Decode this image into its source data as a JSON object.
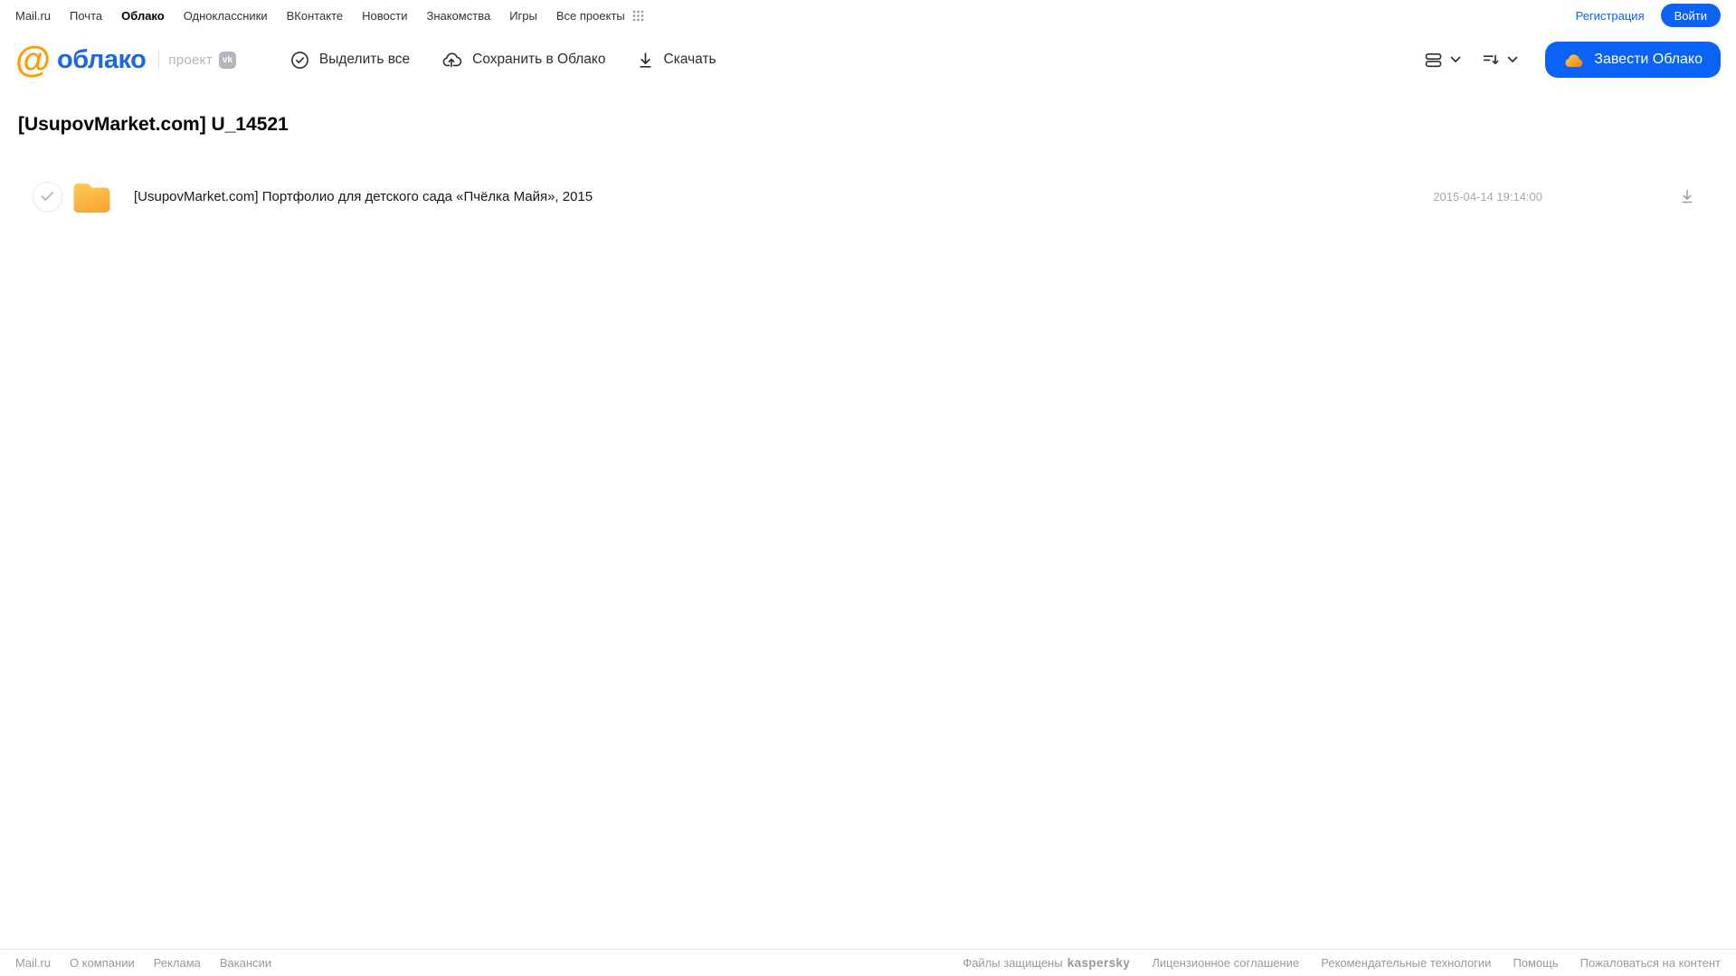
{
  "top_nav": {
    "links": [
      "Mail.ru",
      "Почта",
      "Облако",
      "Одноклассники",
      "ВКонтакте",
      "Новости",
      "Знакомства",
      "Игры",
      "Все проекты"
    ],
    "active_link": "Облако",
    "registration_label": "Регистрация",
    "login_label": "Войти"
  },
  "header": {
    "logo": {
      "at": "@",
      "name": "облако",
      "project": "проект",
      "vk": "vk"
    },
    "actions": {
      "select_all": "Выделить все",
      "save_to_cloud": "Сохранить в Облако",
      "download": "Скачать"
    },
    "get_cloud_label": "Завести Облако"
  },
  "main": {
    "title": "[UsupovMarket.com] U_14521",
    "file": {
      "type": "folder",
      "name": "[UsupovMarket.com] Портфолио для детского сада «Пчёлка Майя», 2015",
      "date": "2015-04-14 19:14:00"
    }
  },
  "footer": {
    "links_left": [
      "Mail.ru",
      "О компании",
      "Реклама",
      "Вакансии"
    ],
    "protected_text": "Файлы защищены",
    "kaspersky_label": "kaspersky",
    "links_right": [
      "Лицензионное соглашение",
      "Рекомендательные технологии",
      "Помощь",
      "Пожаловаться на контент"
    ]
  },
  "colors": {
    "accent_blue": "#0b63f5",
    "logo_orange": "#ff9b04",
    "logo_blue": "#1c68e0",
    "folder_yellow_top": "#fecb55",
    "folder_yellow_bottom": "#f6a93b",
    "kaspersky_green": "#00836d",
    "muted_gray": "#97999d"
  }
}
